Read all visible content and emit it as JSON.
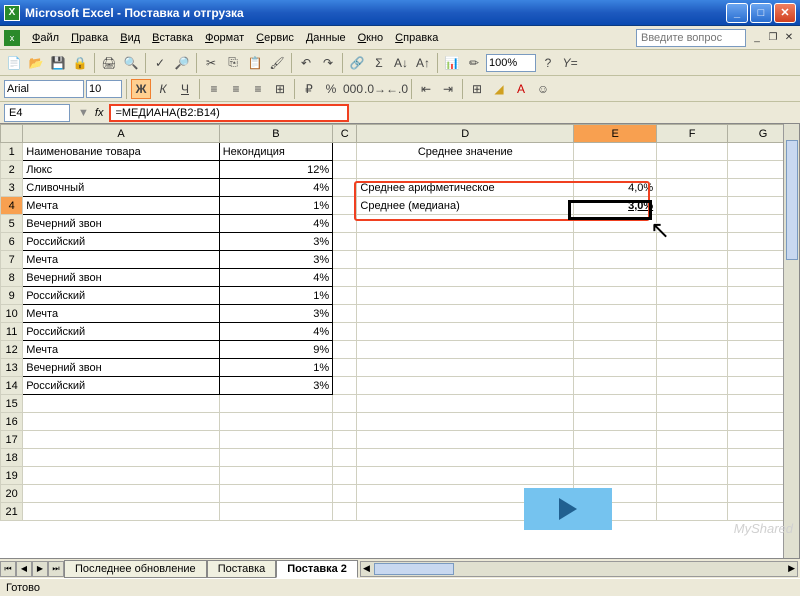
{
  "title": "Microsoft Excel - Поставка и отгрузка",
  "menus": [
    "Файл",
    "Правка",
    "Вид",
    "Вставка",
    "Формат",
    "Сервис",
    "Данные",
    "Окно",
    "Справка"
  ],
  "help_placeholder": "Введите вопрос",
  "zoom": "100%",
  "font": "Arial",
  "font_size": "10",
  "name_box": "E4",
  "fx": "fx",
  "formula": "=МЕДИАНА(B2:B14)",
  "columns": [
    "A",
    "B",
    "C",
    "D",
    "E",
    "F",
    "G"
  ],
  "headers": {
    "A": "Наименование товара",
    "B": "Некондиция",
    "D": "Среднее значение"
  },
  "rows": [
    {
      "n": "2",
      "a": "Люкс",
      "b": "12%"
    },
    {
      "n": "3",
      "a": "Сливочный",
      "b": "4%"
    },
    {
      "n": "4",
      "a": "Мечта",
      "b": "1%"
    },
    {
      "n": "5",
      "a": "Вечерний звон",
      "b": "4%"
    },
    {
      "n": "6",
      "a": "Российский",
      "b": "3%"
    },
    {
      "n": "7",
      "a": "Мечта",
      "b": "3%"
    },
    {
      "n": "8",
      "a": "Вечерний звон",
      "b": "4%"
    },
    {
      "n": "9",
      "a": "Российский",
      "b": "1%"
    },
    {
      "n": "10",
      "a": "Мечта",
      "b": "3%"
    },
    {
      "n": "11",
      "a": "Российский",
      "b": "4%"
    },
    {
      "n": "12",
      "a": "Мечта",
      "b": "9%"
    },
    {
      "n": "13",
      "a": "Вечерний звон",
      "b": "1%"
    },
    {
      "n": "14",
      "a": "Российский",
      "b": "3%"
    }
  ],
  "blank_rows": [
    "15",
    "16",
    "17",
    "18",
    "19",
    "20",
    "21"
  ],
  "stats": {
    "mean_label": "Среднее арифметическое",
    "mean_value": "4,0%",
    "median_label": "Среднее (медиана)",
    "median_value": "3,0%"
  },
  "tabs": {
    "nav": [
      "⏮",
      "◀",
      "▶",
      "⏭"
    ],
    "items": [
      "Последнее обновление",
      "Поставка",
      "Поставка 2"
    ],
    "active": 2
  },
  "status": "Готово",
  "watermark": "MyShared"
}
